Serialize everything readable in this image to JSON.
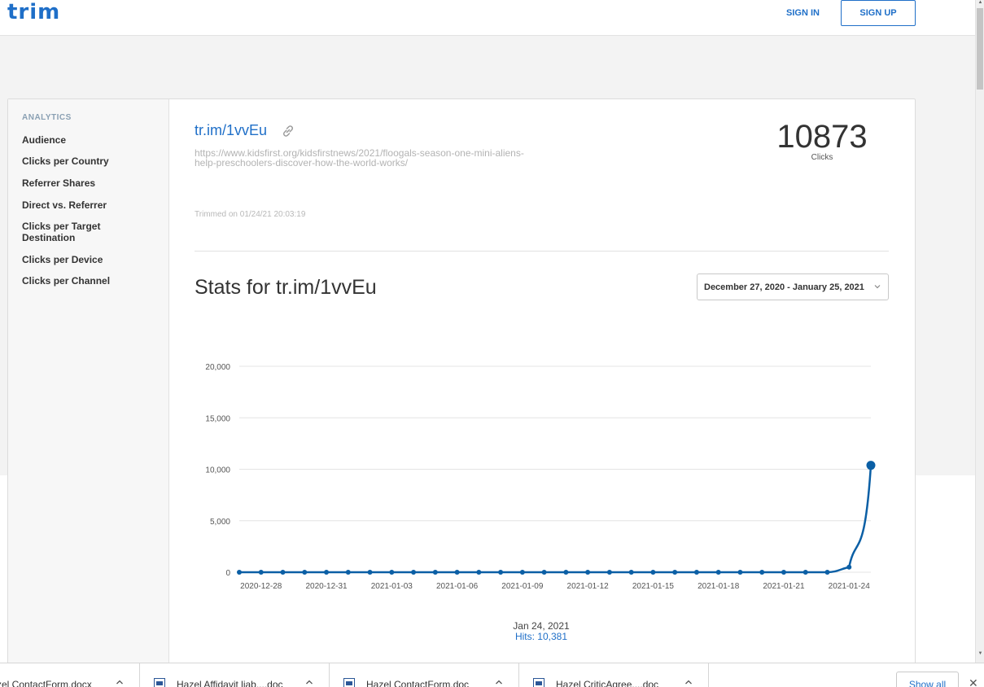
{
  "header": {
    "logo": "trim",
    "sign_in": "SIGN IN",
    "sign_up": "SIGN UP"
  },
  "sidebar": {
    "heading": "ANALYTICS",
    "items": [
      {
        "label": "Audience"
      },
      {
        "label": "Clicks per Country"
      },
      {
        "label": "Referrer Shares"
      },
      {
        "label": "Direct vs. Referrer"
      },
      {
        "label": "Clicks per Target Destination"
      },
      {
        "label": "Clicks per Device"
      },
      {
        "label": "Clicks per Channel"
      }
    ]
  },
  "link": {
    "short": "tr.im/1vvEu",
    "long_line1": "https://www.kidsfirst.org/kidsfirstnews/2021/floogals-season-one-mini-aliens-",
    "long_line2": "help-preschoolers-discover-how-the-world-works/",
    "trimmed": "Trimmed on 01/24/21 20:03:19",
    "clicks": "10873",
    "clicks_label": "Clicks"
  },
  "stats": {
    "title": "Stats for tr.im/1vvEu",
    "date_range": "December 27, 2020 - January 25, 2021"
  },
  "chart_data": {
    "type": "line",
    "x": [
      "2020-12-27",
      "2020-12-28",
      "2020-12-29",
      "2020-12-30",
      "2020-12-31",
      "2021-01-01",
      "2021-01-02",
      "2021-01-03",
      "2021-01-04",
      "2021-01-05",
      "2021-01-06",
      "2021-01-07",
      "2021-01-08",
      "2021-01-09",
      "2021-01-10",
      "2021-01-11",
      "2021-01-12",
      "2021-01-13",
      "2021-01-14",
      "2021-01-15",
      "2021-01-16",
      "2021-01-17",
      "2021-01-18",
      "2021-01-19",
      "2021-01-20",
      "2021-01-21",
      "2021-01-22",
      "2021-01-23",
      "2021-01-24",
      "2021-01-25"
    ],
    "values": [
      0,
      0,
      0,
      0,
      0,
      0,
      0,
      0,
      0,
      0,
      0,
      0,
      0,
      0,
      0,
      0,
      0,
      0,
      0,
      0,
      0,
      0,
      0,
      0,
      0,
      0,
      0,
      0,
      492,
      10381
    ],
    "x_tick_labels": [
      "2020-12-28",
      "2020-12-31",
      "2021-01-03",
      "2021-01-06",
      "2021-01-09",
      "2021-01-12",
      "2021-01-15",
      "2021-01-18",
      "2021-01-21",
      "2021-01-24"
    ],
    "x_tick_indices": [
      1,
      4,
      7,
      10,
      13,
      16,
      19,
      22,
      25,
      28
    ],
    "y_ticks": [
      0,
      5000,
      10000,
      15000,
      20000
    ],
    "y_tick_labels": [
      "0",
      "5,000",
      "10,000",
      "15,000",
      "20,000"
    ],
    "ylim": [
      0,
      20000
    ],
    "grid": true,
    "color": "#0b5fa5",
    "highlight_index": 29
  },
  "tooltip": {
    "date": "Jan 24, 2021",
    "hits": "Hits: 10,381"
  },
  "downloads": {
    "items": [
      {
        "name": "zel ContactForm.docx"
      },
      {
        "name": "Hazel Affidavit liab....doc"
      },
      {
        "name": "Hazel ContactForm.doc"
      },
      {
        "name": "Hazel CriticAgree....doc"
      }
    ],
    "show_all": "Show all",
    "close": "✕"
  }
}
